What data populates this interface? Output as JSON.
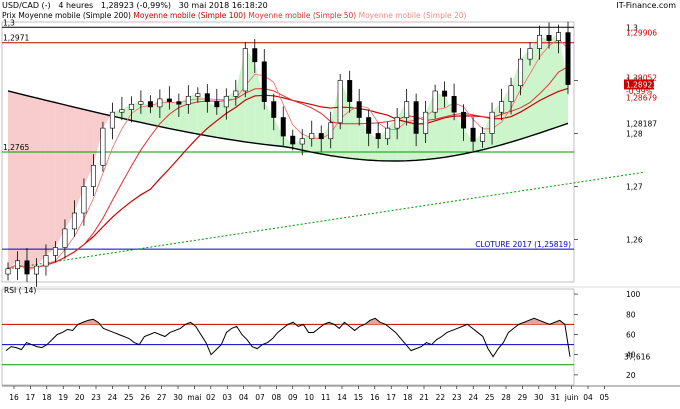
{
  "header": {
    "symbol": "USD/CAD (-)",
    "timeframe": "4 heures",
    "last": "1,28923 (-0,99%)",
    "datetime": "30 mai 2018 16:18:20",
    "brand": "IT-Finance.com"
  },
  "legend": [
    {
      "label": "Prix Moyenne mobile (Simple 200)",
      "color": "#000000"
    },
    {
      "label": "Moyenne mobile (Simple 100)",
      "color": "#cc0000"
    },
    {
      "label": "Moyenne mobile (Simple 50)",
      "color": "#e84a4a"
    },
    {
      "label": "Moyenne mobile (Simple 20)",
      "color": "#f08a8a"
    }
  ],
  "colors": {
    "candle": "#000000",
    "sma200": "#000000",
    "sma100": "#cc0000",
    "sma50": "#e03030",
    "sma20": "#f07878",
    "fill_bull": "#ccf5cc",
    "fill_bear": "#f8cccc",
    "level_black": "#000000",
    "level_red": "#cc0000",
    "level_green": "#009900",
    "level_blue": "#0000cc",
    "trend_green": "#009900",
    "last_badge": "#cc0000"
  },
  "chart_data": [
    {
      "type": "candlestick",
      "title": "USD/CAD (-) 4 heures",
      "x_labels": [
        "16",
        "17",
        "18",
        "19",
        "20",
        "23",
        "24",
        "25",
        "26",
        "27",
        "30",
        "mai",
        "02",
        "03",
        "04",
        "07",
        "08",
        "09",
        "10",
        "11",
        "14",
        "15",
        "16",
        "17",
        "18",
        "21",
        "22",
        "23",
        "24",
        "25",
        "28",
        "29",
        "30",
        "31",
        "juin",
        "04",
        "05"
      ],
      "ylim": [
        1.252,
        1.301
      ],
      "y_ticks": [
        1.26,
        1.27,
        1.28,
        1.29
      ],
      "y_tick_labels": [
        "1,26",
        "1,27",
        "1,28",
        "1,29"
      ],
      "close_series": [
        1.2545,
        1.256,
        1.2535,
        1.255,
        1.257,
        1.2585,
        1.262,
        1.265,
        1.27,
        1.274,
        1.281,
        1.284,
        1.2845,
        1.2855,
        1.286,
        1.285,
        1.2865,
        1.286,
        1.2855,
        1.287,
        1.2875,
        1.286,
        1.285,
        1.287,
        1.288,
        1.296,
        1.2935,
        1.286,
        1.283,
        1.2795,
        1.278,
        1.279,
        1.28,
        1.279,
        1.282,
        1.29,
        1.286,
        1.283,
        1.28,
        1.279,
        1.281,
        1.283,
        1.286,
        1.28,
        1.284,
        1.288,
        1.287,
        1.284,
        1.281,
        1.2785,
        1.28,
        1.284,
        1.286,
        1.289,
        1.294,
        1.296,
        1.2985,
        1.2975,
        1.299,
        1.2892
      ],
      "levels": [
        {
          "value": 1.3,
          "label": "1,3",
          "color": "#000000"
        },
        {
          "value": 1.2971,
          "label": "1,2971",
          "color": "#cc0000"
        },
        {
          "value": 1.2765,
          "label": "1,2765",
          "color": "#009900"
        },
        {
          "value": 1.25819,
          "label": "CLOTURE 2017 (1,25819)",
          "color": "#0000cc"
        }
      ],
      "trendline": {
        "from": [
          0,
          1.2545
        ],
        "to": [
          59,
          1.2712
        ],
        "color": "#009900",
        "style": "dotted"
      },
      "right_labels": [
        {
          "value": 1.29906,
          "label": "1,29906",
          "color": "#cc0000"
        },
        {
          "value": 1.29052,
          "label": "1,29052",
          "color": "#cc0000"
        },
        {
          "value": 1.28923,
          "label": "1,28923",
          "color": "#ffffff",
          "badge": "#cc0000"
        },
        {
          "value": 1.288,
          "label": "-0,99%",
          "color": "#cc0000"
        },
        {
          "value": 1.28679,
          "label": "1,28679",
          "color": "#cc0000"
        },
        {
          "value": 1.28187,
          "label": "1,28187",
          "color": "#000000"
        }
      ],
      "sma200_endpoints": [
        1.288,
        1.2819
      ],
      "legend_position": "top-left"
    },
    {
      "type": "line",
      "title": "RSI ( 14)",
      "ylim": [
        10,
        105
      ],
      "y_ticks": [
        20,
        40,
        60,
        80,
        100
      ],
      "y_tick_labels": [
        "20",
        "40",
        "60",
        "80",
        "100"
      ],
      "levels": [
        {
          "value": 70,
          "color": "#cc0000"
        },
        {
          "value": 50,
          "color": "#0000cc"
        },
        {
          "value": 30,
          "color": "#009900"
        }
      ],
      "last_value_label": "37,616",
      "values": [
        44,
        48,
        47,
        45,
        52,
        50,
        48,
        47,
        50,
        55,
        60,
        62,
        65,
        64,
        70,
        72,
        74,
        75,
        72,
        66,
        64,
        62,
        60,
        58,
        56,
        52,
        50,
        58,
        60,
        62,
        60,
        58,
        62,
        64,
        66,
        70,
        72,
        68,
        60,
        52,
        40,
        45,
        50,
        62,
        66,
        68,
        60,
        55,
        48,
        46,
        50,
        52,
        56,
        62,
        66,
        70,
        72,
        68,
        70,
        62,
        62,
        66,
        70,
        72,
        70,
        66,
        72,
        68,
        64,
        68,
        70,
        74,
        76,
        72,
        70,
        66,
        62,
        56,
        50,
        44,
        46,
        48,
        52,
        50,
        55,
        58,
        62,
        64,
        66,
        68,
        70,
        66,
        62,
        58,
        46,
        38,
        46,
        52,
        62,
        66,
        70,
        72,
        74,
        76,
        74,
        72,
        70,
        72,
        74,
        70,
        38
      ]
    }
  ]
}
